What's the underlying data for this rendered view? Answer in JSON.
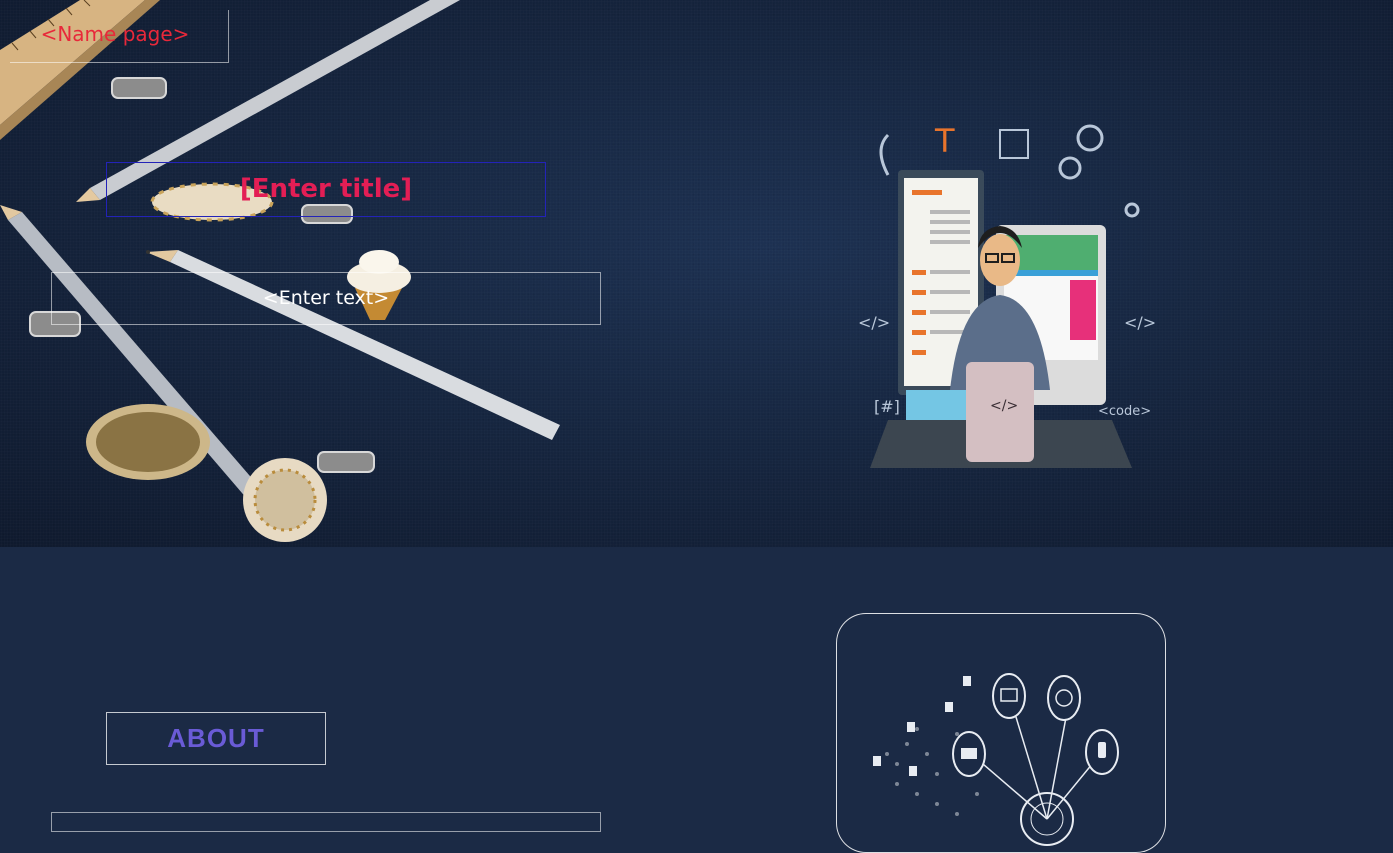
{
  "hero": {
    "name_page": "<Name page>",
    "title": "[Enter title]",
    "text": "<Enter text>"
  },
  "about": {
    "heading": "ABOUT"
  },
  "colors": {
    "background": "#1b2a45",
    "hero_dark": "#15243d",
    "name_page_red": "#e8283a",
    "title_pink": "#e31e55",
    "title_border": "#2323b8",
    "about_purple": "#6a5bd6"
  },
  "icons": [
    "pencil-icon",
    "ruler-icon",
    "binder-clip-icon",
    "washi-tape-icon",
    "ice-cream-icon",
    "developer-illustration",
    "network-globe-illustration"
  ]
}
